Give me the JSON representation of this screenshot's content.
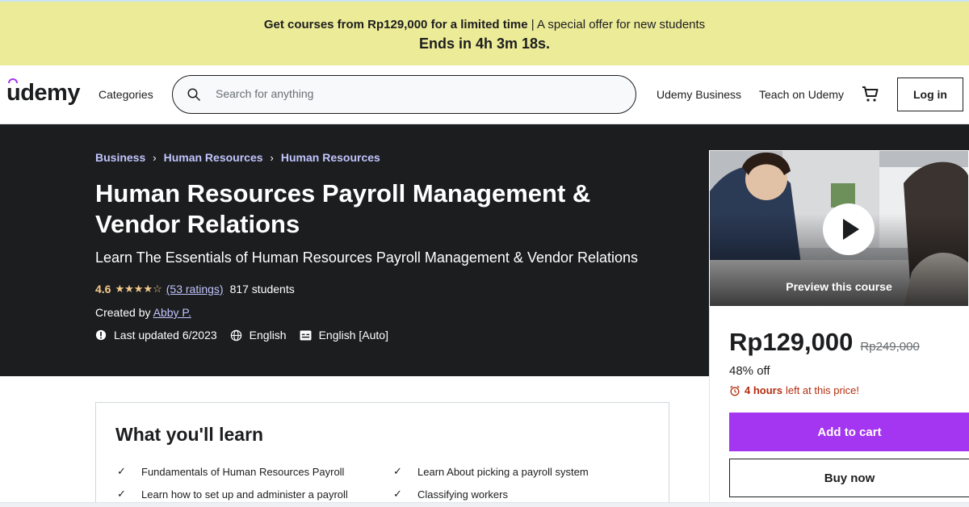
{
  "promo": {
    "strong": "Get courses from Rp129,000 for a limited time",
    "rest": " | A special offer for new students",
    "countdown": "Ends in 4h 3m 18s."
  },
  "header": {
    "logo": "udemy",
    "categories": "Categories",
    "search_placeholder": "Search for anything",
    "business": "Udemy Business",
    "teach": "Teach on Udemy",
    "login": "Log in"
  },
  "hero": {
    "breadcrumb": [
      "Business",
      "Human Resources",
      "Human Resources"
    ],
    "title": "Human Resources Payroll Management & Vendor Relations",
    "subtitle": "Learn The Essentials of Human Resources Payroll Management & Vendor Relations",
    "rating": "4.6",
    "stars": "★★★★☆",
    "ratings_link": "(53 ratings)",
    "students": "817 students",
    "created_by": "Created by ",
    "author": "Abby P.",
    "last_updated": "Last updated 6/2023",
    "language": "English",
    "captions": "English [Auto]"
  },
  "sidebar": {
    "preview_label": "Preview this course",
    "price": "Rp129,000",
    "old_price": "Rp249,000",
    "discount": "48% off",
    "timer_strong": "4 hours",
    "timer_rest": "left at this price!",
    "add_to_cart": "Add to cart",
    "buy_now": "Buy now"
  },
  "learn": {
    "title": "What you'll learn",
    "items": [
      "Fundamentals of Human Resources Payroll",
      "Learn About picking a payroll system",
      "Learn how to set up and administer a payroll",
      "Classifying workers"
    ]
  },
  "colors": {
    "accent": "#a435f0",
    "dark_bg": "#1c1d1f",
    "promo_bg": "#eceb98",
    "link": "#c0c4fc",
    "star": "#f3ca8c",
    "alert": "#b32d0f"
  }
}
